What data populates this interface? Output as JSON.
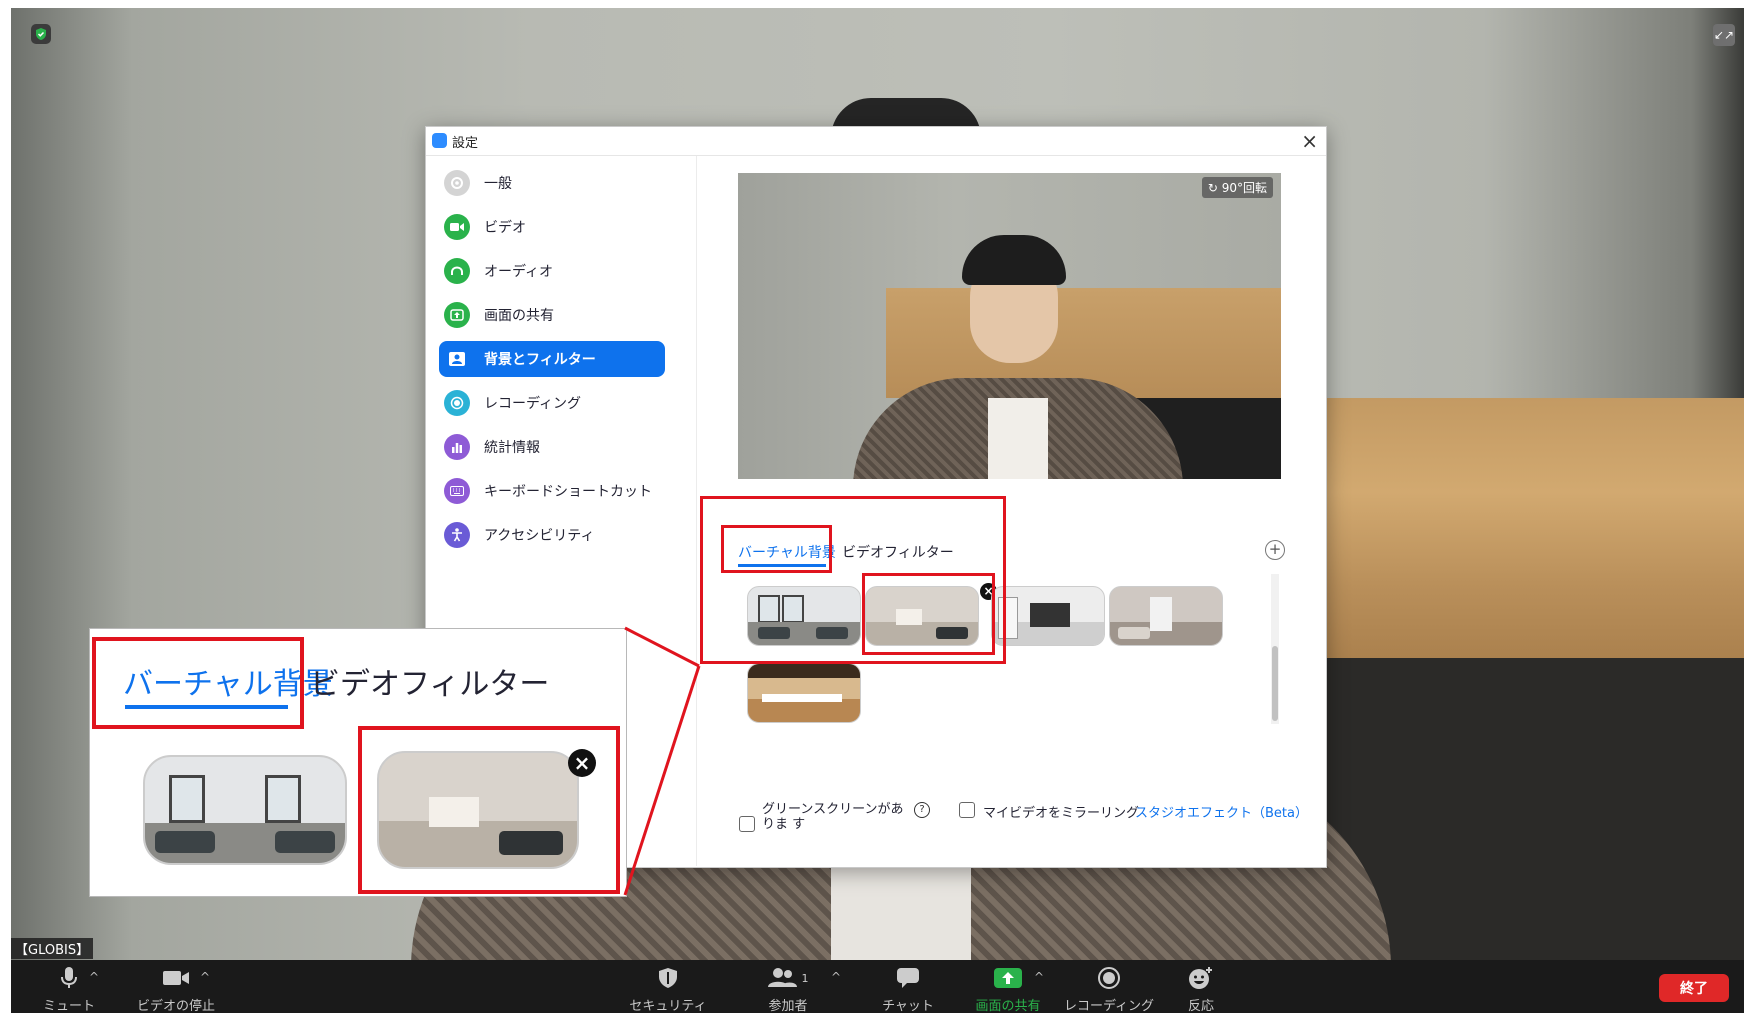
{
  "meeting": {
    "name_label": "【GLOBIS】",
    "fullscreen_icon": "↙↗"
  },
  "dialog": {
    "title": "設定",
    "close_icon": "×",
    "sidebar": [
      {
        "label": "一般",
        "icon": "gear-icon",
        "color": "#b8b8b8"
      },
      {
        "label": "ビデオ",
        "icon": "video-icon",
        "color": "#2ab24b"
      },
      {
        "label": "オーディオ",
        "icon": "headphones-icon",
        "color": "#2ab24b"
      },
      {
        "label": "画面の共有",
        "icon": "share-screen-icon",
        "color": "#2ab24b"
      },
      {
        "label": "背景とフィルター",
        "icon": "background-icon",
        "color": "#0e72ed",
        "active": true
      },
      {
        "label": "レコーディング",
        "icon": "recording-icon",
        "color": "#2ab2d6"
      },
      {
        "label": "統計情報",
        "icon": "statistics-icon",
        "color": "#8e5bd6"
      },
      {
        "label": "キーボードショートカット",
        "icon": "keyboard-icon",
        "color": "#8e5bd6"
      },
      {
        "label": "アクセシビリティ",
        "icon": "accessibility-icon",
        "color": "#6a5bd6"
      }
    ],
    "preview": {
      "rotate_label": "90°回転"
    },
    "tabs": {
      "virtual": "バーチャル背景",
      "filter": "ビデオフィルター"
    },
    "add_icon": "+",
    "remove_icon": "×",
    "options": {
      "green_screen": "グリーンスクリーンがありま す",
      "help_icon": "?",
      "mirror": "マイビデオをミラーリング",
      "studio": "スタジオエフェクト（Beta）"
    }
  },
  "callout": {
    "virtual": "バーチャル背景",
    "filter": "ビデオフィルター"
  },
  "toolbar": {
    "items": [
      {
        "label": "ミュート",
        "icon": "microphone-icon"
      },
      {
        "label": "ビデオの停止",
        "icon": "camera-icon"
      },
      {
        "label": "セキュリティ",
        "icon": "shield-icon"
      },
      {
        "label": "参加者",
        "icon": "participants-icon",
        "count": "1"
      },
      {
        "label": "チャット",
        "icon": "chat-icon"
      },
      {
        "label": "画面の共有",
        "icon": "share-screen-icon",
        "highlight": "#2ab24b"
      },
      {
        "label": "レコーディング",
        "icon": "record-icon"
      },
      {
        "label": "反応",
        "icon": "reaction-icon"
      }
    ],
    "caret": "^",
    "end_label": "終了"
  }
}
